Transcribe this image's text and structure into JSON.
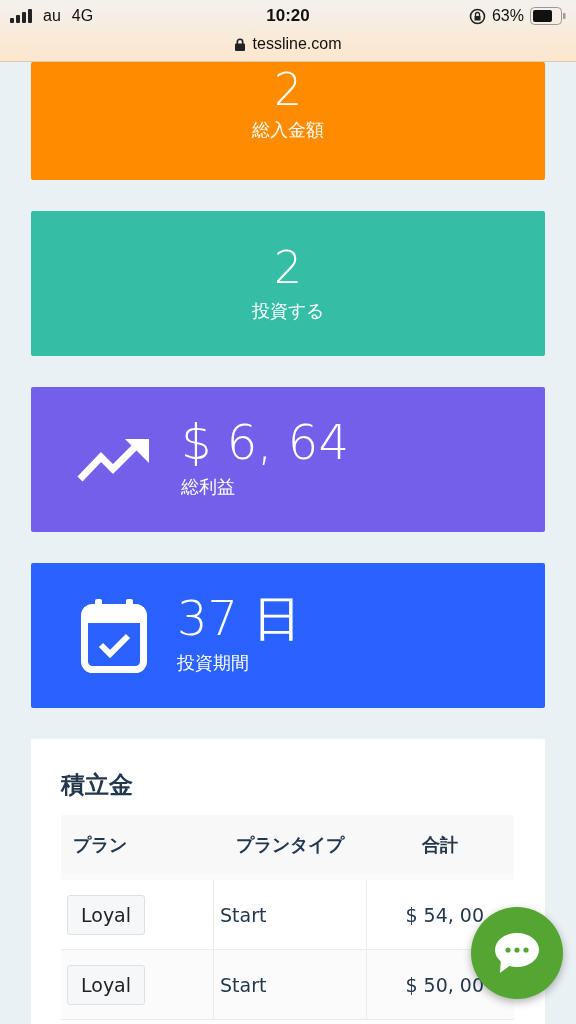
{
  "status_bar": {
    "carrier": "au",
    "network": "4G",
    "time": "10:20",
    "battery": "63%",
    "url": "tessline.com"
  },
  "cards": [
    {
      "kind": "centered",
      "color": "#ff8c00",
      "value": "2",
      "label": "総入金額"
    },
    {
      "kind": "centered",
      "color": "#35bea5",
      "value": "2",
      "label": "投資する"
    },
    {
      "kind": "trend",
      "color": "#735fea",
      "value": "$ 6, 64",
      "label": "総利益"
    },
    {
      "kind": "calendar",
      "color": "#2962ff",
      "value": "37 日",
      "label": "投資期間"
    }
  ],
  "savings": {
    "title": "積立金",
    "columns": [
      "プラン",
      "プランタイプ",
      "合計"
    ],
    "rows": [
      {
        "plan": "Loyal",
        "type": "Start",
        "total": "$ 54, 00"
      },
      {
        "plan": "Loyal",
        "type": "Start",
        "total": "$ 50, 00"
      }
    ]
  }
}
